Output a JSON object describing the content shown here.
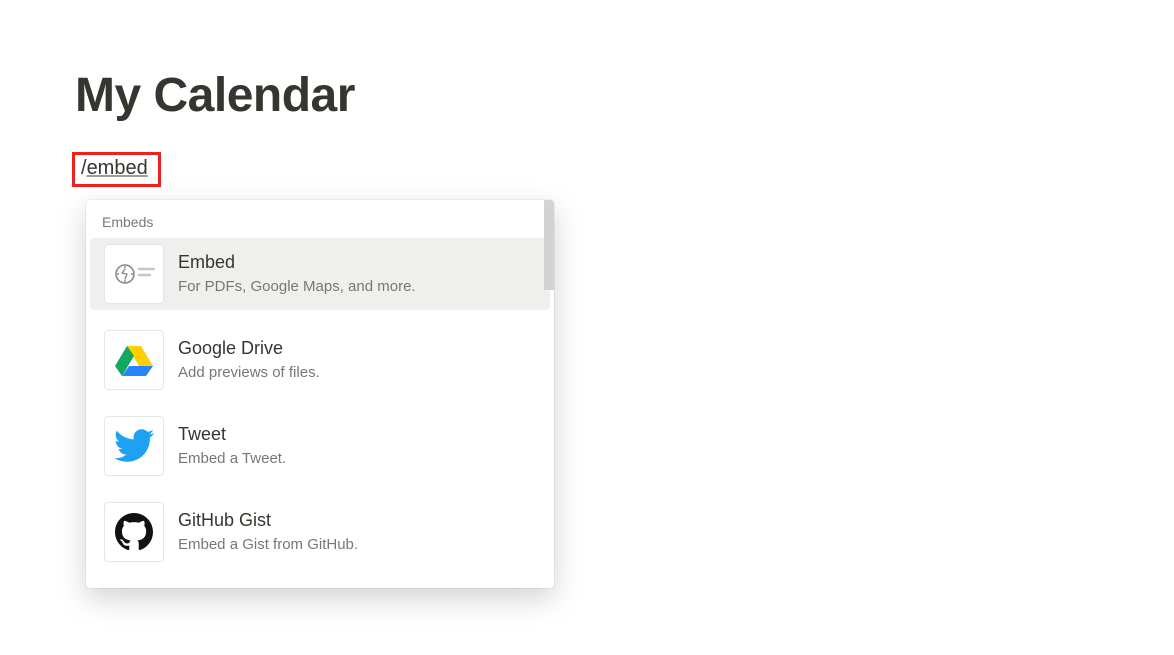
{
  "page": {
    "title": "My Calendar"
  },
  "slash_command": {
    "prefix": "/",
    "text": "embed"
  },
  "dropdown": {
    "section_label": "Embeds",
    "items": [
      {
        "title": "Embed",
        "desc": "For PDFs, Google Maps, and more.",
        "icon": "embed-icon",
        "highlighted": true
      },
      {
        "title": "Google Drive",
        "desc": "Add previews of files.",
        "icon": "google-drive-icon",
        "highlighted": false
      },
      {
        "title": "Tweet",
        "desc": "Embed a Tweet.",
        "icon": "twitter-icon",
        "highlighted": false
      },
      {
        "title": "GitHub Gist",
        "desc": "Embed a Gist from GitHub.",
        "icon": "github-icon",
        "highlighted": false
      }
    ]
  }
}
